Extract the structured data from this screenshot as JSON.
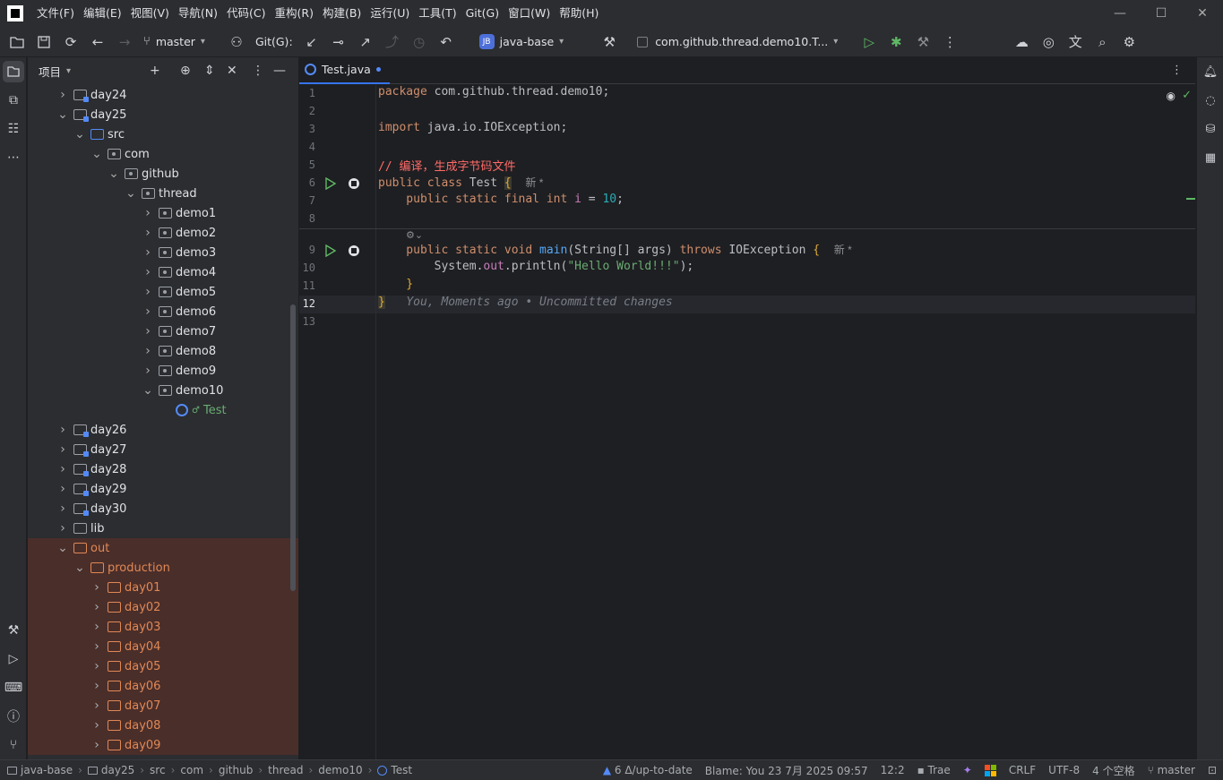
{
  "menus": [
    "文件(F)",
    "编辑(E)",
    "视图(V)",
    "导航(N)",
    "代码(C)",
    "重构(R)",
    "构建(B)",
    "运行(U)",
    "工具(T)",
    "Git(G)",
    "窗口(W)",
    "帮助(H)"
  ],
  "toolbar": {
    "branch": "master",
    "git_label": "Git(G):",
    "project": "java-base",
    "project_badge": "JB",
    "run_config": "com.github.thread.demo10.T..."
  },
  "project_panel": {
    "title": "项目",
    "tree": [
      {
        "label": "day24",
        "indent": 1,
        "chev": ">",
        "icon": "module"
      },
      {
        "label": "day25",
        "indent": 1,
        "chev": "v",
        "icon": "module"
      },
      {
        "label": "src",
        "indent": 2,
        "chev": "v",
        "icon": "src"
      },
      {
        "label": "com",
        "indent": 3,
        "chev": "v",
        "icon": "package"
      },
      {
        "label": "github",
        "indent": 4,
        "chev": "v",
        "icon": "package"
      },
      {
        "label": "thread",
        "indent": 5,
        "chev": "v",
        "icon": "package"
      },
      {
        "label": "demo1",
        "indent": 6,
        "chev": ">",
        "icon": "package"
      },
      {
        "label": "demo2",
        "indent": 6,
        "chev": ">",
        "icon": "package"
      },
      {
        "label": "demo3",
        "indent": 6,
        "chev": ">",
        "icon": "package"
      },
      {
        "label": "demo4",
        "indent": 6,
        "chev": ">",
        "icon": "package"
      },
      {
        "label": "demo5",
        "indent": 6,
        "chev": ">",
        "icon": "package"
      },
      {
        "label": "demo6",
        "indent": 6,
        "chev": ">",
        "icon": "package"
      },
      {
        "label": "demo7",
        "indent": 6,
        "chev": ">",
        "icon": "package"
      },
      {
        "label": "demo8",
        "indent": 6,
        "chev": ">",
        "icon": "package"
      },
      {
        "label": "demo9",
        "indent": 6,
        "chev": ">",
        "icon": "package"
      },
      {
        "label": "demo10",
        "indent": 6,
        "chev": "v",
        "icon": "package"
      },
      {
        "label": "Test",
        "indent": 7,
        "chev": "",
        "icon": "java"
      },
      {
        "label": "day26",
        "indent": 1,
        "chev": ">",
        "icon": "module"
      },
      {
        "label": "day27",
        "indent": 1,
        "chev": ">",
        "icon": "module"
      },
      {
        "label": "day28",
        "indent": 1,
        "chev": ">",
        "icon": "module"
      },
      {
        "label": "day29",
        "indent": 1,
        "chev": ">",
        "icon": "module"
      },
      {
        "label": "day30",
        "indent": 1,
        "chev": ">",
        "icon": "module"
      },
      {
        "label": "lib",
        "indent": 1,
        "chev": ">",
        "icon": "folder"
      },
      {
        "label": "out",
        "indent": 1,
        "chev": "v",
        "icon": "excluded"
      },
      {
        "label": "production",
        "indent": 2,
        "chev": "v",
        "icon": "excluded"
      },
      {
        "label": "day01",
        "indent": 3,
        "chev": ">",
        "icon": "excluded"
      },
      {
        "label": "day02",
        "indent": 3,
        "chev": ">",
        "icon": "excluded"
      },
      {
        "label": "day03",
        "indent": 3,
        "chev": ">",
        "icon": "excluded"
      },
      {
        "label": "day04",
        "indent": 3,
        "chev": ">",
        "icon": "excluded"
      },
      {
        "label": "day05",
        "indent": 3,
        "chev": ">",
        "icon": "excluded"
      },
      {
        "label": "day06",
        "indent": 3,
        "chev": ">",
        "icon": "excluded"
      },
      {
        "label": "day07",
        "indent": 3,
        "chev": ">",
        "icon": "excluded"
      },
      {
        "label": "day08",
        "indent": 3,
        "chev": ">",
        "icon": "excluded"
      },
      {
        "label": "day09",
        "indent": 3,
        "chev": ">",
        "icon": "excluded"
      }
    ]
  },
  "editor": {
    "tab": "Test.java",
    "line_numbers": [
      "1",
      "2",
      "3",
      "4",
      "5",
      "6",
      "7",
      "8",
      "9",
      "10",
      "11",
      "12",
      "13"
    ],
    "hint_new": "新 *",
    "blame_inline": "You, Moments ago • Uncommitted changes",
    "code": {
      "l1_kw": "package",
      "l1_rest": " com.github.thread.demo10;",
      "l3_kw": "import",
      "l3_rest": " java.io.IOException;",
      "l5": "// 编译，生成字节码文件",
      "l6_kw": "public class",
      "l6_name": " Test ",
      "l6_brace": "{",
      "l7_kw": "    public static final int",
      "l7_var": " i",
      "l7_eq": " = ",
      "l7_num": "10",
      "l7_end": ";",
      "l9_kw": "    public static void",
      "l9_fn": " main",
      "l9_a": "(String[] args) ",
      "l9_kw2": "throws",
      "l9_b": " IOException ",
      "l9_brace": "{",
      "l10_a": "        System.",
      "l10_fld": "out",
      "l10_b": ".println(",
      "l10_str": "\"Hello World!!!\"",
      "l10_c": ");",
      "l11": "    }",
      "l12": "}"
    }
  },
  "statusbar": {
    "crumbs": [
      "java-base",
      "day25",
      "src",
      "com",
      "github",
      "thread",
      "demo10",
      "Test"
    ],
    "vcs": "6 Δ/up-to-date",
    "blame": "Blame: You 23 7月 2025 09:57",
    "position": "12:2",
    "trae": "Trae",
    "line_sep": "CRLF",
    "encoding": "UTF-8",
    "indent": "4 个空格",
    "branch": "master"
  }
}
